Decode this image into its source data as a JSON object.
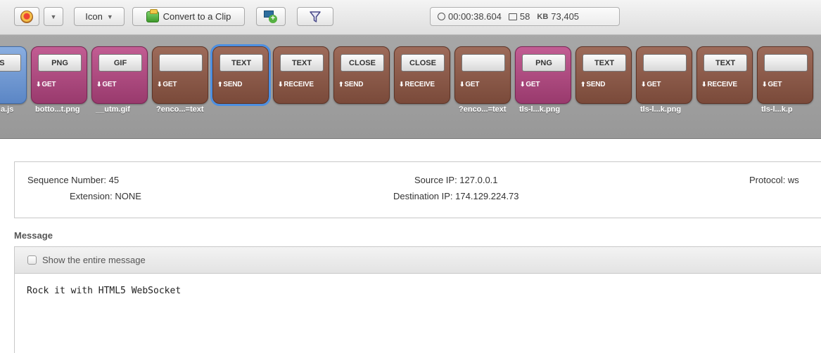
{
  "toolbar": {
    "view_dropdown": "Icon",
    "convert_label": "Convert to a Clip",
    "stats": {
      "time": "00:00:38.604",
      "frames": "58",
      "kb_label": "KB",
      "kb_value": "73,405"
    }
  },
  "timeline": {
    "frames": [
      {
        "type": "US",
        "direction": "ET",
        "arrow": "",
        "label": "a.js",
        "color": "blue",
        "selected": false
      },
      {
        "type": "PNG",
        "direction": "GET",
        "arrow": "down",
        "label": "botto...t.png",
        "color": "pink",
        "selected": false
      },
      {
        "type": "GIF",
        "direction": "GET",
        "arrow": "down",
        "label": "__utm.gif",
        "color": "pink",
        "selected": false
      },
      {
        "type": "",
        "direction": "GET",
        "arrow": "down",
        "label": "?enco...=text",
        "color": "brown",
        "selected": false
      },
      {
        "type": "TEXT",
        "direction": "SEND",
        "arrow": "up",
        "label": "",
        "color": "brown",
        "selected": true
      },
      {
        "type": "TEXT",
        "direction": "RECEIVE",
        "arrow": "down",
        "label": "",
        "color": "brown",
        "selected": false
      },
      {
        "type": "CLOSE",
        "direction": "SEND",
        "arrow": "up",
        "label": "",
        "color": "brown",
        "selected": false
      },
      {
        "type": "CLOSE",
        "direction": "RECEIVE",
        "arrow": "down",
        "label": "",
        "color": "brown",
        "selected": false
      },
      {
        "type": "",
        "direction": "GET",
        "arrow": "down",
        "label": "?enco...=text",
        "color": "brown",
        "selected": false
      },
      {
        "type": "PNG",
        "direction": "GET",
        "arrow": "down",
        "label": "tls-l...k.png",
        "color": "pink",
        "selected": false
      },
      {
        "type": "TEXT",
        "direction": "SEND",
        "arrow": "up",
        "label": "",
        "color": "brown",
        "selected": false
      },
      {
        "type": "",
        "direction": "GET",
        "arrow": "down",
        "label": "tls-l...k.png",
        "color": "brown",
        "selected": false
      },
      {
        "type": "TEXT",
        "direction": "RECEIVE",
        "arrow": "down",
        "label": "",
        "color": "brown",
        "selected": false
      },
      {
        "type": "",
        "direction": "GET",
        "arrow": "down",
        "label": "tls-l...k.p",
        "color": "brown",
        "selected": false
      }
    ]
  },
  "details": {
    "sequence_number": "Sequence Number: 45",
    "extension": "Extension: NONE",
    "source_ip": "Source IP: 127.0.0.1",
    "destination_ip": "Destination IP: 174.129.224.73",
    "protocol": "Protocol: ws"
  },
  "message": {
    "title": "Message",
    "show_entire_label": "Show the entire message",
    "body": "Rock it with HTML5 WebSocket"
  },
  "colors": {
    "pink": "#b24d83",
    "brown": "#8a5a4a",
    "blue": "#6f97d3",
    "selected_outline": "#4d8fe0"
  }
}
